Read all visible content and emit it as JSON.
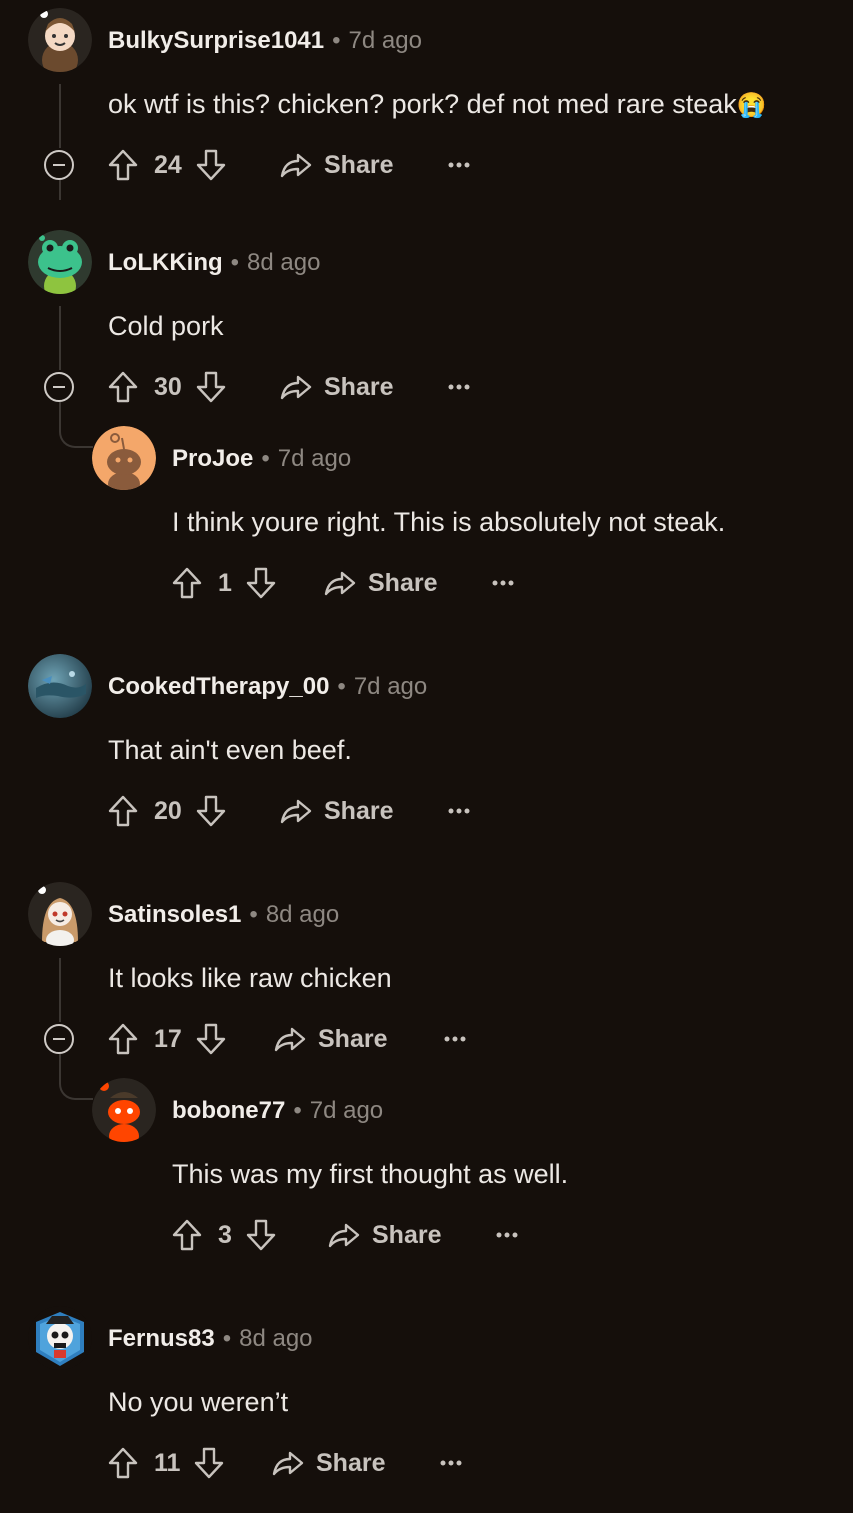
{
  "comments": [
    {
      "user": "BulkySurprise1041",
      "time": "7d ago",
      "text": "ok wtf is this? chicken? pork? def not med rare steak",
      "emoji": "😭",
      "votes": "24",
      "share": "Share"
    },
    {
      "user": "LoLKKing",
      "time": "8d ago",
      "text": "Cold pork",
      "votes": "30",
      "share": "Share"
    },
    {
      "user": "ProJoe",
      "time": "7d ago",
      "text": "I think youre right. This is absolutely not steak.",
      "votes": "1",
      "share": "Share"
    },
    {
      "user": "CookedTherapy_00",
      "time": "7d ago",
      "text": "That ain't even beef.",
      "votes": "20",
      "share": "Share"
    },
    {
      "user": "Satinsoles1",
      "time": "8d ago",
      "text": "It looks like raw chicken",
      "votes": "17",
      "share": "Share"
    },
    {
      "user": "bobone77",
      "time": "7d ago",
      "text": "This was my first thought as well.",
      "votes": "3",
      "share": "Share"
    },
    {
      "user": "Fernus83",
      "time": "8d ago",
      "text": "No you weren’t",
      "votes": "11",
      "share": "Share"
    }
  ],
  "separator": "•",
  "icons": {
    "upvote": "arrow-up-outline-icon",
    "downvote": "arrow-down-outline-icon",
    "share": "share-arrow-icon",
    "more": "ellipsis-icon",
    "collapse": "minus-circle-icon"
  }
}
